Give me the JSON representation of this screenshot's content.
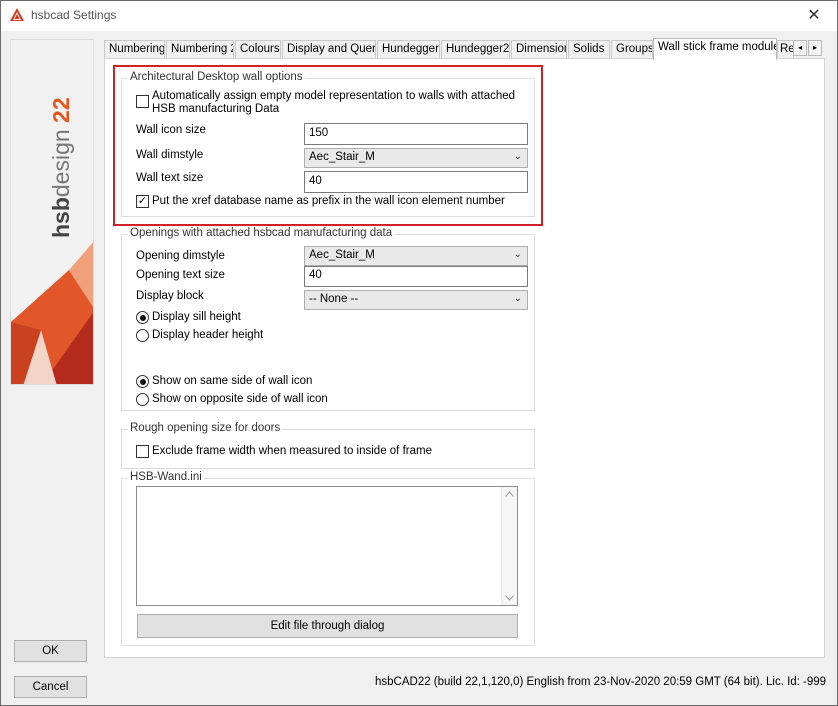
{
  "window": {
    "title": "hsbcad Settings",
    "close_glyph": "✕"
  },
  "brand": {
    "logo_text": "hsbdesign 22",
    "accent": "#e8551f"
  },
  "tabs": [
    {
      "label": "Numbering"
    },
    {
      "label": "Numbering 2"
    },
    {
      "label": "Colours"
    },
    {
      "label": "Display and Query"
    },
    {
      "label": "Hundegger"
    },
    {
      "label": "Hundegger2"
    },
    {
      "label": "Dimension"
    },
    {
      "label": "Solids"
    },
    {
      "label": "Groups"
    },
    {
      "label": "Wall stick frame module"
    },
    {
      "label": "Re"
    }
  ],
  "tab_scroll": {
    "left": "◂",
    "right": "▸"
  },
  "adt": {
    "title": "Architectural Desktop wall options",
    "auto_assign_label": "Automatically assign empty model representation to walls with attached HSB manufacturing Data",
    "auto_assign_checked": false,
    "wall_icon_size_label": "Wall icon size",
    "wall_icon_size_value": "150",
    "wall_dimstyle_label": "Wall dimstyle",
    "wall_dimstyle_value": "Aec_Stair_M",
    "wall_text_size_label": "Wall text size",
    "wall_text_size_value": "40",
    "xref_prefix_label": "Put the xref database name as prefix in the wall icon element number",
    "xref_prefix_checked": true
  },
  "openings": {
    "title": "Openings with attached hsbcad manufacturing data",
    "dimstyle_label": "Opening dimstyle",
    "dimstyle_value": "Aec_Stair_M",
    "text_size_label": "Opening text size",
    "text_size_value": "40",
    "display_block_label": "Display block",
    "display_block_value": "-- None --",
    "sill_label": "Display sill height",
    "header_label": "Display header height",
    "same_side_label": "Show on same side of wall icon",
    "opposite_side_label": "Show on opposite side of wall icon",
    "height_selected": "sill",
    "side_selected": "same"
  },
  "rough": {
    "title": "Rough opening size for doors",
    "exclude_label": "Exclude frame width when measured to inside of frame",
    "exclude_checked": false
  },
  "ini": {
    "title": "HSB-Wand.ini",
    "content": "",
    "edit_button": "Edit file through dialog"
  },
  "buttons": {
    "ok": "OK",
    "cancel": "Cancel"
  },
  "status": "hsbCAD22 (build 22,1,120,0) English from 23-Nov-2020 20:59 GMT (64 bit). Lic. Id: -999",
  "checkmark": "✓",
  "highlight_color": "#d0202a"
}
